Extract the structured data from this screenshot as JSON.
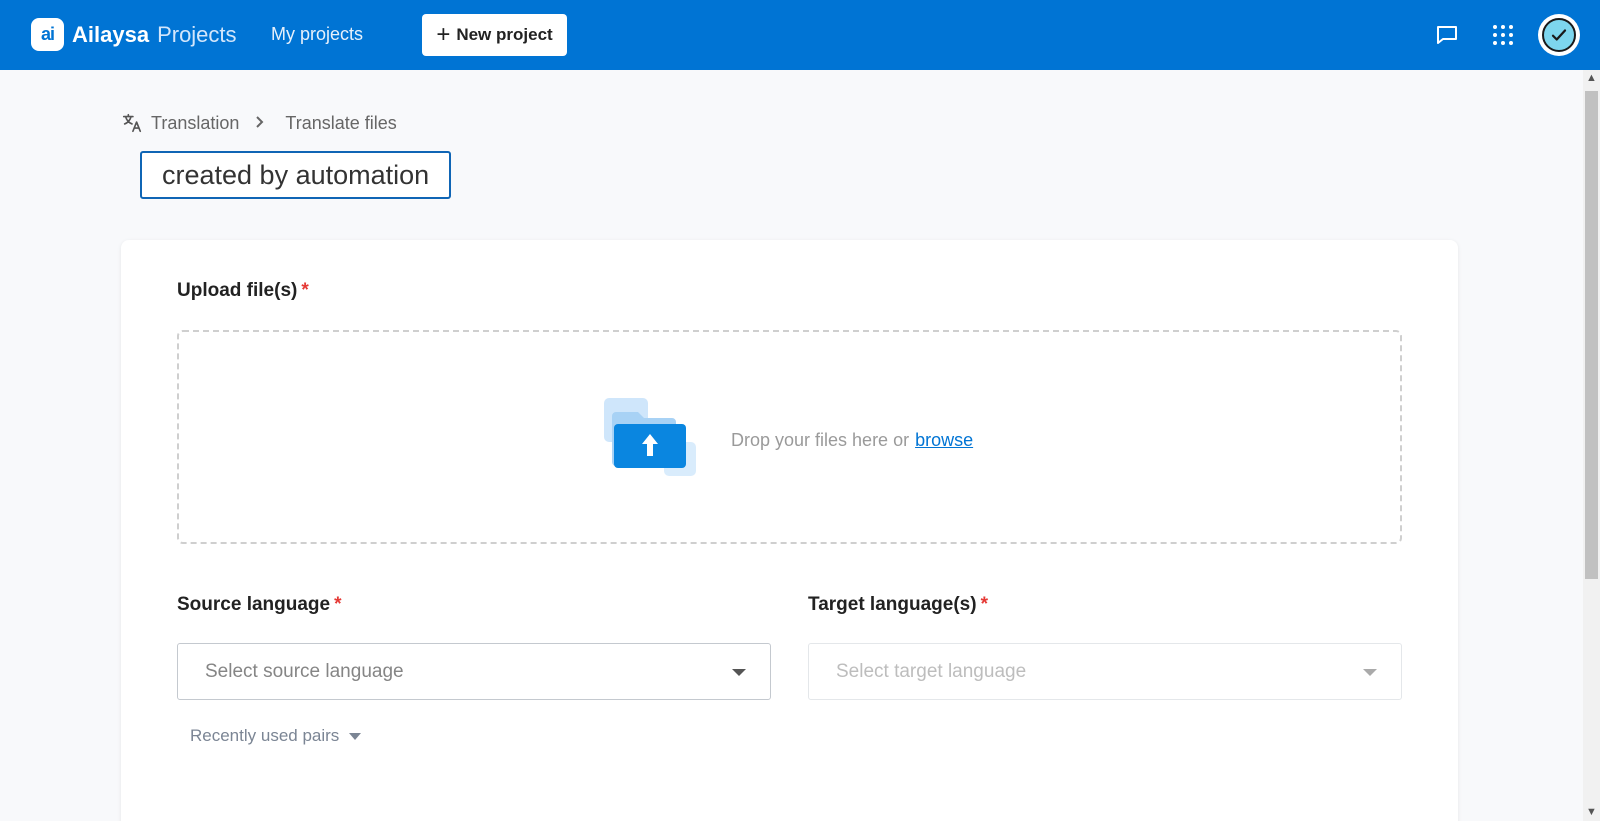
{
  "header": {
    "logo_mark": "ai",
    "brand": "Ailaysa",
    "product": "Projects",
    "nav_my_projects": "My projects",
    "new_project_label": "New project",
    "icons": [
      "chat-icon",
      "apps-grid-icon",
      "avatar-check-icon"
    ]
  },
  "breadcrumb": {
    "items": [
      "Translation",
      "Translate files"
    ]
  },
  "project_title": "created by automation",
  "upload": {
    "label": "Upload file(s)",
    "required_mark": "*",
    "drop_text": "Drop your files here or",
    "browse_link": "browse"
  },
  "source": {
    "label": "Source language",
    "required_mark": "*",
    "placeholder": "Select source language"
  },
  "target": {
    "label": "Target language(s)",
    "required_mark": "*",
    "placeholder": "Select target language"
  },
  "recent_pairs_label": "Recently used pairs",
  "colors": {
    "brand_blue": "#0074d4",
    "required_red": "#e53935",
    "title_border": "#0f65b5"
  }
}
